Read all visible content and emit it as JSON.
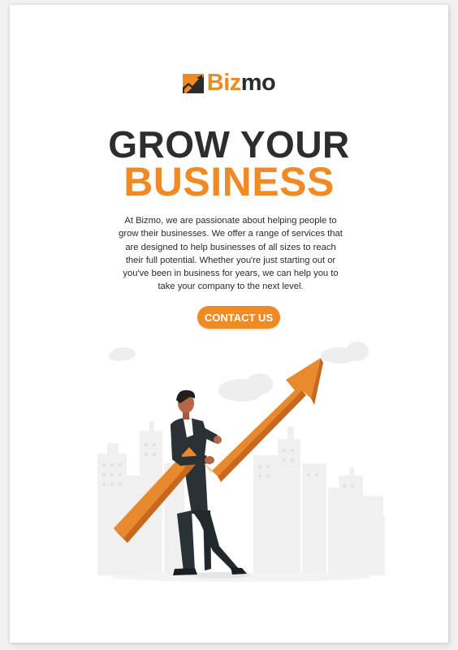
{
  "brand": {
    "logo_text_part1": "Biz",
    "logo_text_part2": "mo",
    "logo_icon": "chart-arrow-logo-icon",
    "accent_color": "#f08a24",
    "dark_color": "#2d2d2d"
  },
  "hero": {
    "headline_line1": "GROW YOUR",
    "headline_line2": "BUSINESS",
    "description": "At Bizmo, we are passionate about helping people to grow their businesses. We offer a range of services that are designed to help businesses of all sizes to reach their full potential. Whether you're just starting out or you've been in business for years, we can help you to take your company to the next level.",
    "cta_label": "CONTACT US"
  },
  "illustration": {
    "subject": "businessman-carrying-growth-arrow",
    "icon": "growth-arrow-icon"
  }
}
